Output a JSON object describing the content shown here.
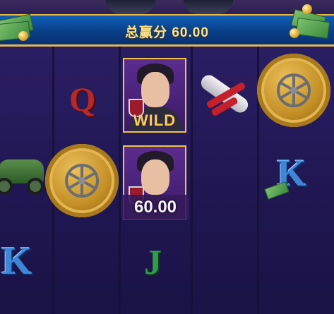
{
  "banner": {
    "total_win_label": "总赢分 60.00"
  },
  "reels": {
    "symbols": {
      "q": "Q",
      "k": "K",
      "j": "J"
    },
    "wild_label": "WILD"
  },
  "win_display": {
    "amount": "60.00"
  },
  "colors": {
    "banner_blue": "#0a3f88",
    "gold_border": "#e7b94a",
    "reel_bg": "#1f1650"
  }
}
